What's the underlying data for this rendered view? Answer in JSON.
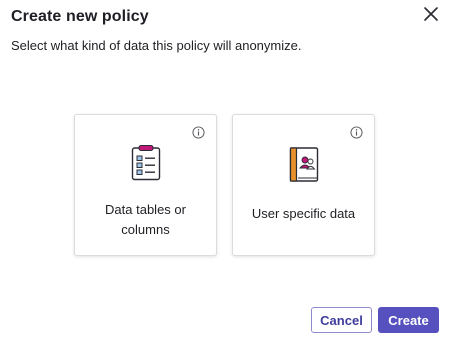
{
  "dialog": {
    "title": "Create new policy",
    "subtitle": "Select what kind of data this policy will anonymize.",
    "close_icon": "close-icon"
  },
  "cards": [
    {
      "label": "Data tables or columns",
      "icon": "checklist-clipboard-icon",
      "info_icon": "info-icon"
    },
    {
      "label": "User specific data",
      "icon": "user-book-icon",
      "info_icon": "info-icon"
    }
  ],
  "footer": {
    "cancel_label": "Cancel",
    "create_label": "Create"
  },
  "colors": {
    "primary": "#5651be",
    "accent_magenta": "#c2187a",
    "book_orange": "#e8902c"
  }
}
